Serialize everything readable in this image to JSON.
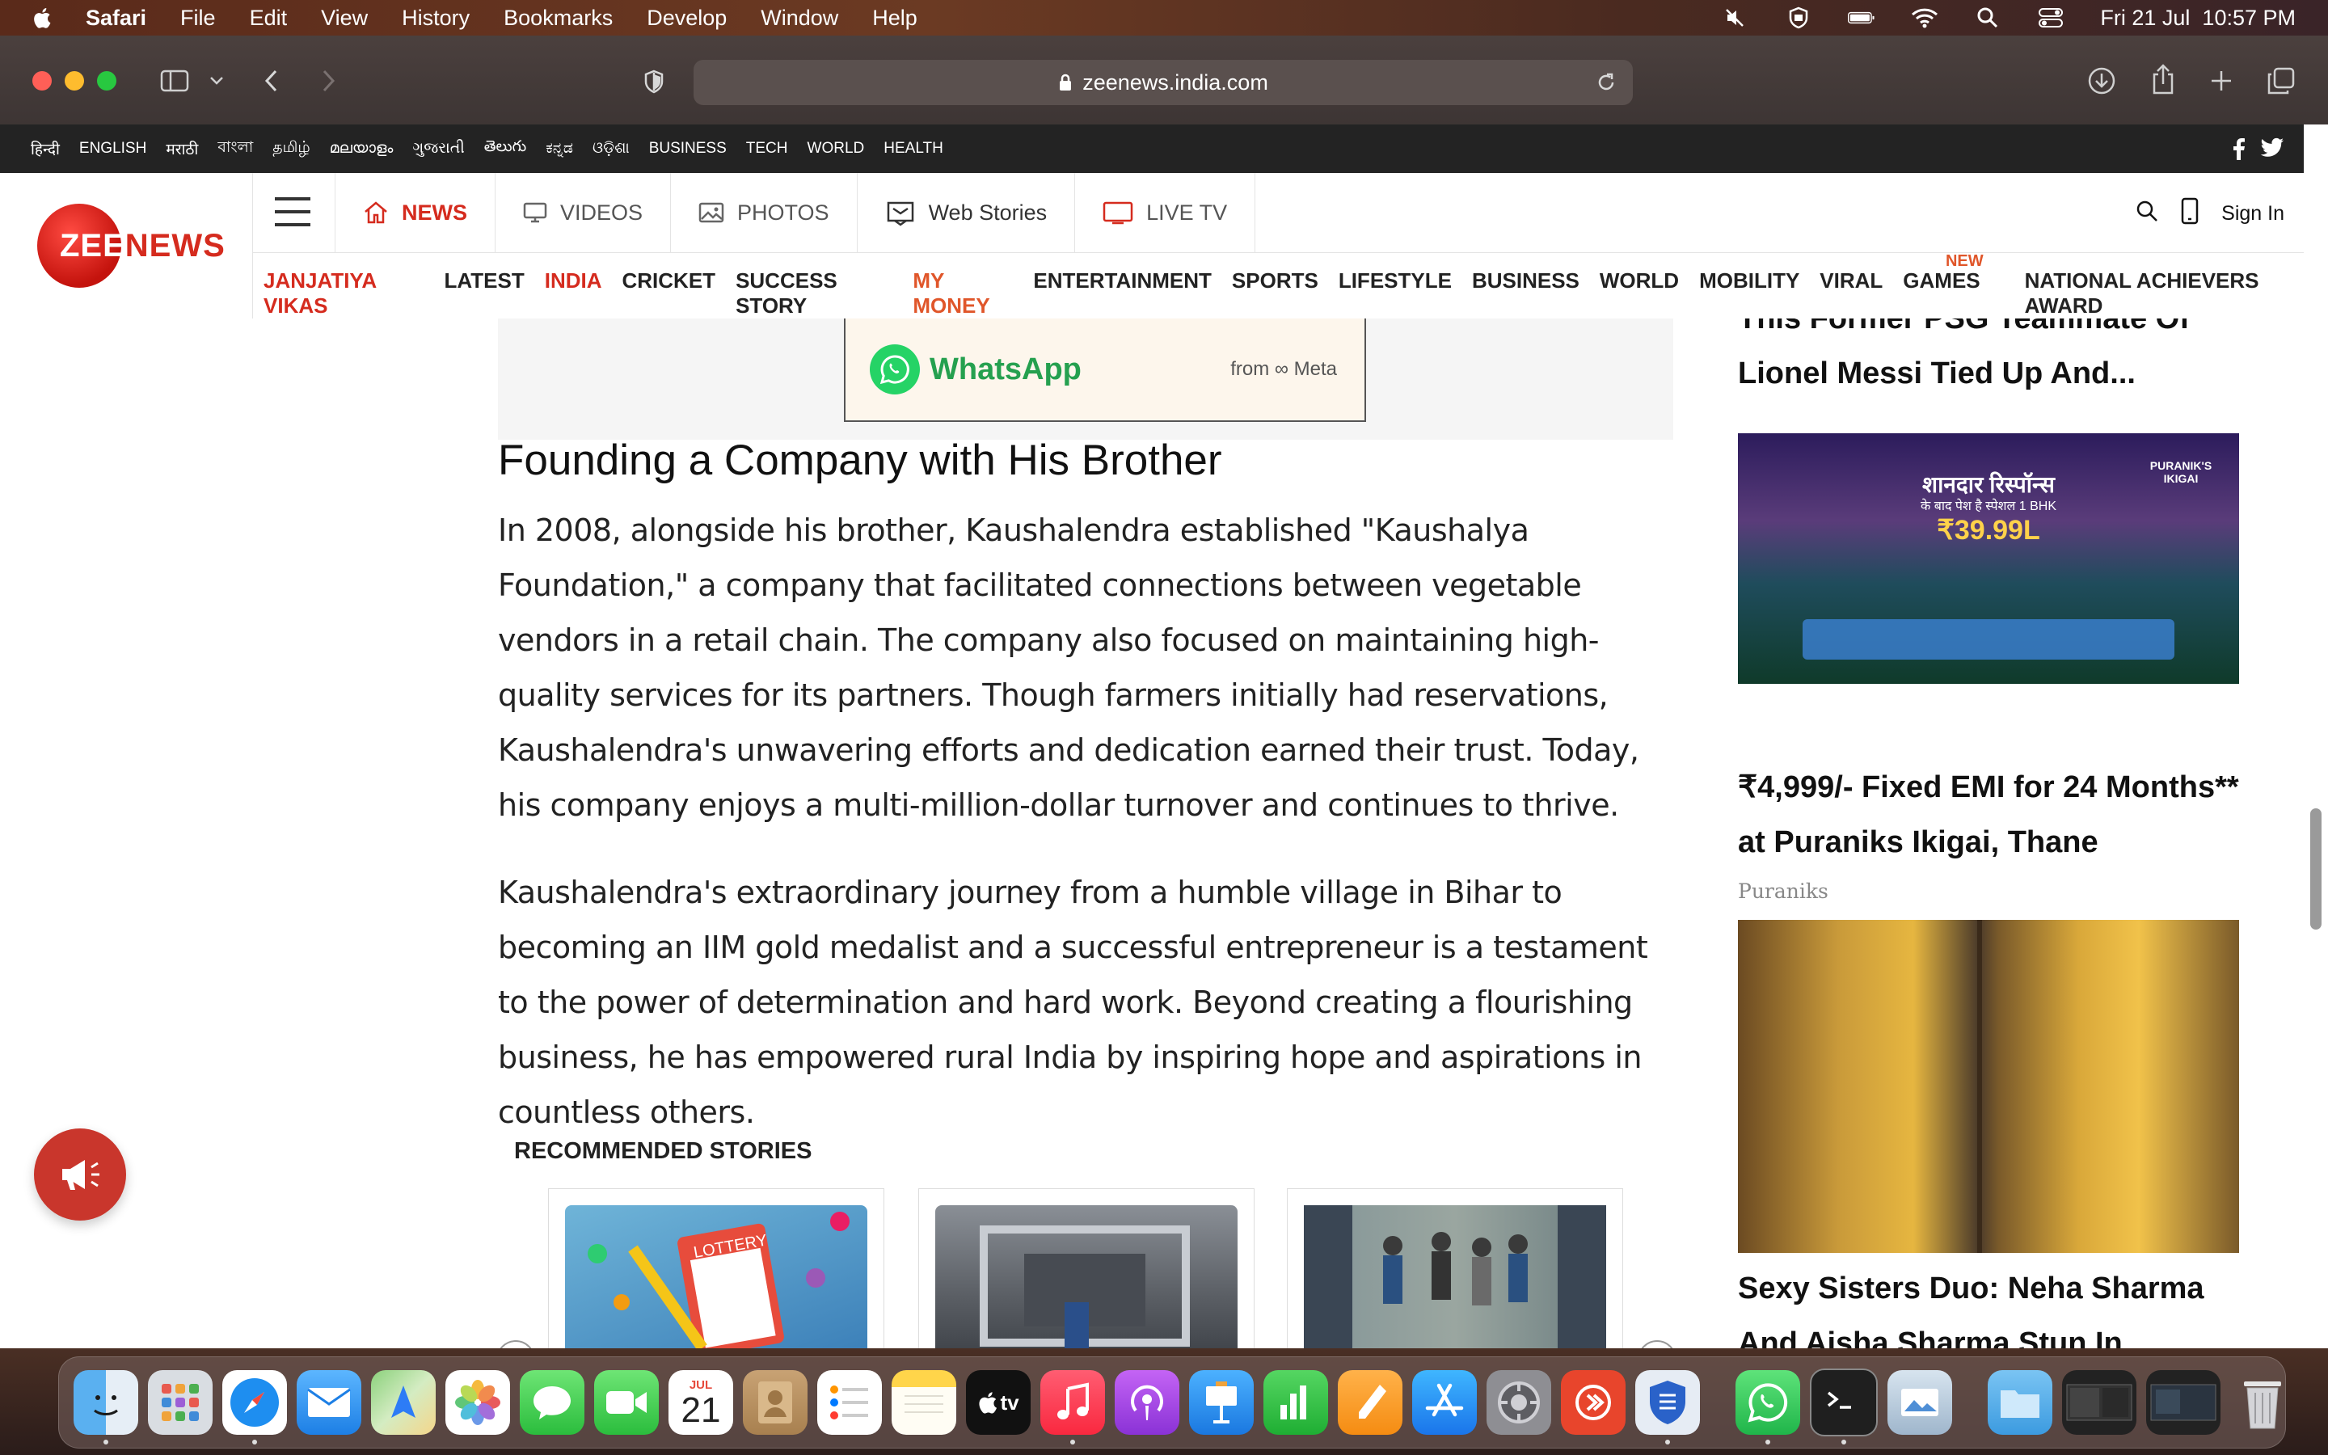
{
  "menubar": {
    "app_name": "Safari",
    "items": [
      "File",
      "Edit",
      "View",
      "History",
      "Bookmarks",
      "Develop",
      "Window",
      "Help"
    ],
    "datetime": "Fri 21 Jul  10:57 PM"
  },
  "browser": {
    "url": "zeenews.india.com"
  },
  "site": {
    "languages": [
      "हिन्दी",
      "ENGLISH",
      "मराठी",
      "বাংলা",
      "தமிழ்",
      "മലയാളം",
      "ગુજરાતી",
      "తెలుగు",
      "ಕನ್ನಡ",
      "ଓଡ଼ିଶା",
      "BUSINESS",
      "TECH",
      "WORLD",
      "HEALTH"
    ],
    "logo": {
      "zee": "ZEE",
      "news": "NEWS"
    },
    "primary_nav": [
      "NEWS",
      "VIDEOS",
      "PHOTOS",
      "Web Stories",
      "LIVE TV"
    ],
    "sign_in": "Sign In",
    "secondary_nav": [
      "JANJATIYA VIKAS",
      "LATEST",
      "INDIA",
      "CRICKET",
      "SUCCESS STORY",
      "MY MONEY",
      "ENTERTAINMENT",
      "SPORTS",
      "LIFESTYLE",
      "BUSINESS",
      "WORLD",
      "MOBILITY",
      "VIRAL",
      "GAMES",
      "NATIONAL ACHIEVERS AWARD"
    ],
    "new_badge": "NEW"
  },
  "ad_top": {
    "brand": "WhatsApp",
    "from": "from ∞ Meta"
  },
  "article": {
    "heading": "Founding a Company with His Brother",
    "para1": "In 2008, alongside his brother, Kaushalendra established \"Kaushalya Foundation,\" a company that facilitated connections between vegetable vendors in a retail chain. The company also focused on maintaining high-quality services for its partners. Though farmers initially had reservations, Kaushalendra's unwavering efforts and dedication earned their trust. Today, his company enjoys a multi-million-dollar turnover and continues to thrive.",
    "para2": "Kaushalendra's extraordinary journey from a humble village in Bihar to becoming an IIM gold medalist and a successful entrepreneur is a testament to the power of determination and hard work. Beyond creating a flourishing business, he has empowered rural India by inspiring hope and aspirations in countless others."
  },
  "recommended": {
    "title": "RECOMMENDED STORIES",
    "card1_label": "LOTTERY"
  },
  "sidebar": {
    "top_headline_line1": "This Former PSG Teammate Of",
    "top_headline_line2": "Lionel Messi Tied Up And...",
    "ad_hindi": "शानदार रिस्पॉन्स",
    "ad_sub": "के बाद पेश है स्पेशल 1 BHK",
    "ad_price": "₹39.99L",
    "ad_brand": "PURANIK'S IKIGAI",
    "promo_line1": "₹4,999/- Fixed EMI for 24 Months**",
    "promo_line2": "at Puraniks Ikigai, Thane",
    "promo_source": "Puraniks",
    "bottom_headline_line1": "Sexy Sisters Duo: Neha Sharma",
    "bottom_headline_line2": "And Aisha Sharma Stun In..."
  },
  "dock": {
    "calendar_month": "JUL",
    "calendar_day": "21",
    "tv_label": "tv"
  },
  "colors": {
    "brand_red": "#d52b1e",
    "accent_orange": "#e0562a",
    "whatsapp_green": "#25d366"
  }
}
